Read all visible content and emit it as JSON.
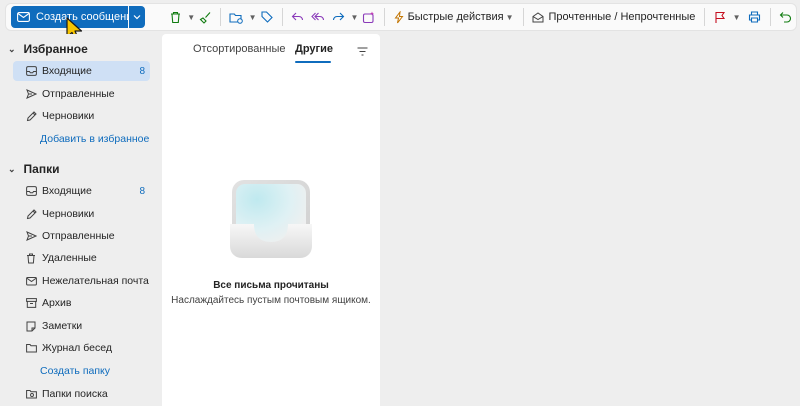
{
  "toolbar": {
    "new_message_label": "Создать сообщение",
    "quick_actions_label": "Быстрые действия",
    "read_unread_label": "Прочтенные / Непрочтенные"
  },
  "favorites": {
    "header": "Избранное",
    "items": [
      {
        "label": "Входящие",
        "count": "8"
      },
      {
        "label": "Отправленные",
        "count": ""
      },
      {
        "label": "Черновики",
        "count": ""
      }
    ],
    "add_link": "Добавить в избранное"
  },
  "folders": {
    "header": "Папки",
    "items": [
      {
        "label": "Входящие",
        "count": "8"
      },
      {
        "label": "Черновики",
        "count": ""
      },
      {
        "label": "Отправленные",
        "count": ""
      },
      {
        "label": "Удаленные",
        "count": ""
      },
      {
        "label": "Нежелательная почта",
        "count": ""
      },
      {
        "label": "Архив",
        "count": ""
      },
      {
        "label": "Заметки",
        "count": ""
      },
      {
        "label": "Журнал бесед",
        "count": ""
      }
    ],
    "create_link": "Создать папку",
    "search_folders": "Папки поиска"
  },
  "message_list": {
    "tabs": [
      {
        "label": "Отсортированные",
        "selected": false
      },
      {
        "label": "Другие",
        "selected": true
      }
    ],
    "empty_title": "Все письма прочитаны",
    "empty_subtitle": "Наслаждайтесь пустым почтовым ящиком."
  },
  "colors": {
    "accent": "#0f6cbd",
    "selected_bg": "#cfe0f5",
    "delete_green": "#107c10",
    "flag_red": "#c50f1f",
    "reply_purple": "#8a3ab9"
  }
}
